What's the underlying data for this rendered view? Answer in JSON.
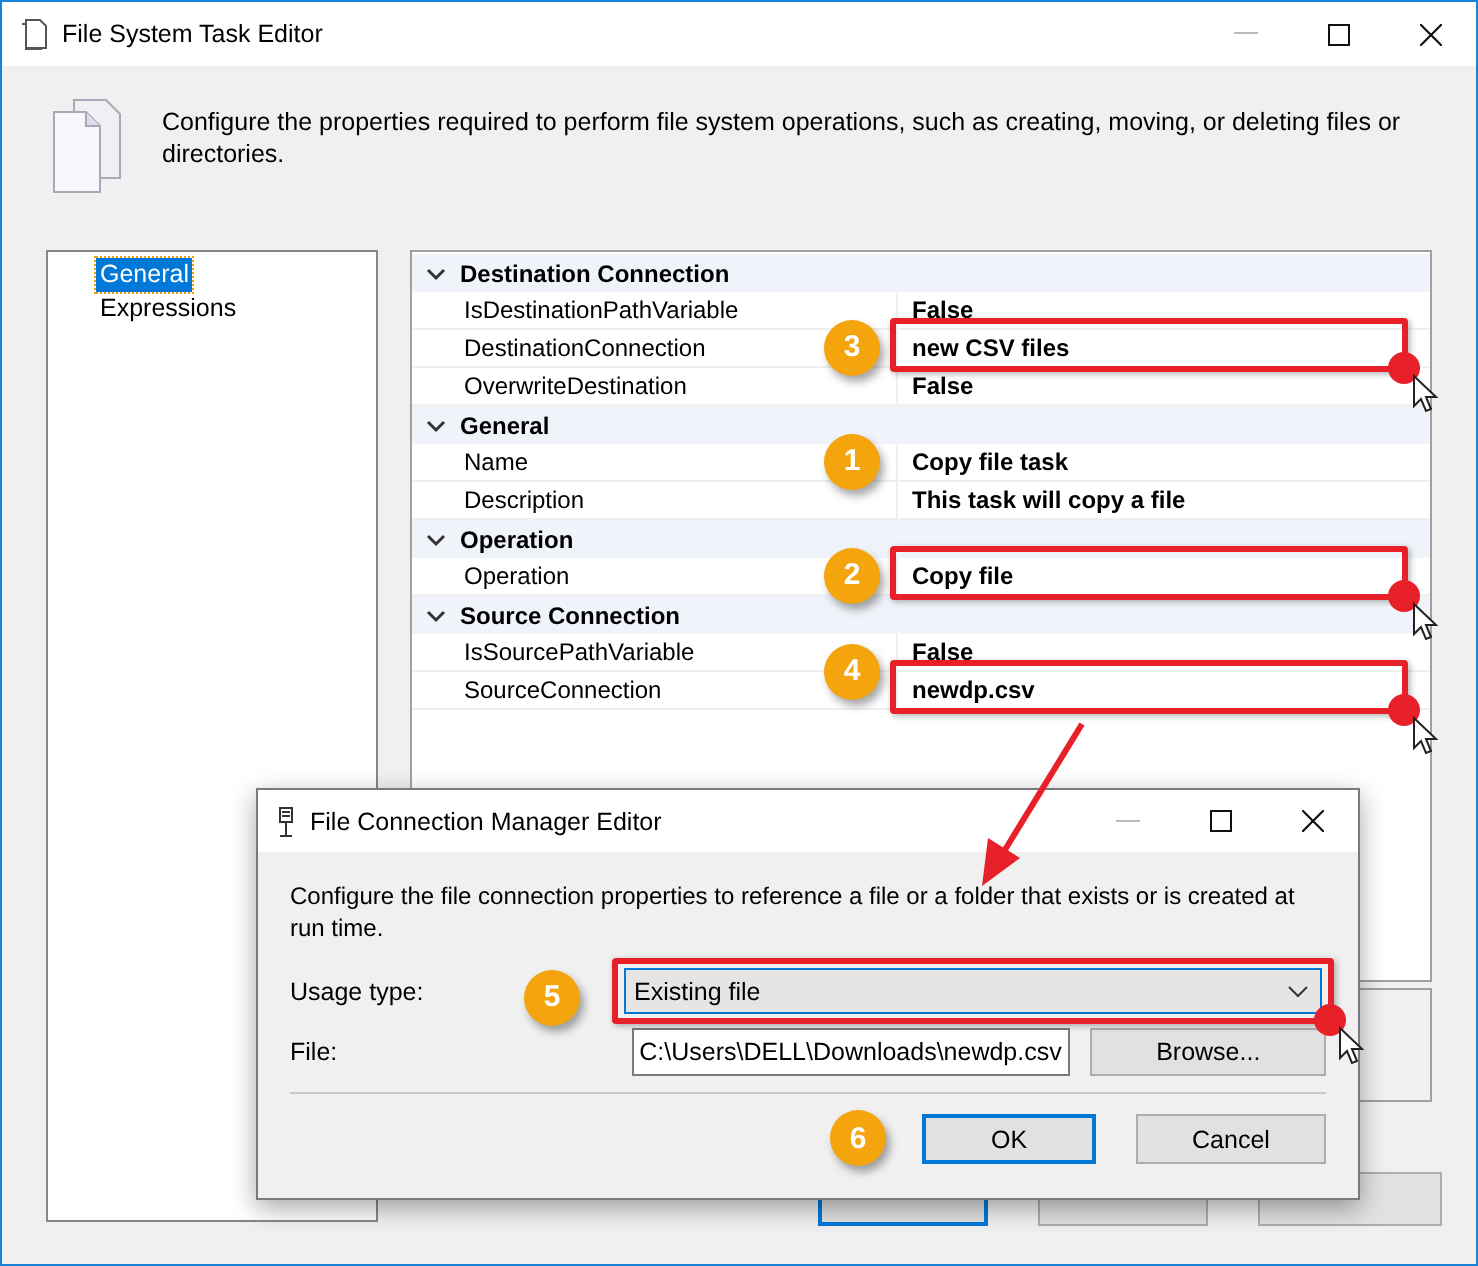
{
  "window": {
    "title": "File System Task Editor",
    "description": "Configure the properties required to perform file system operations, such as creating, moving, or deleting files or directories."
  },
  "pages": [
    {
      "label": "General",
      "selected": true
    },
    {
      "label": "Expressions",
      "selected": false
    }
  ],
  "property_grid": {
    "categories": [
      {
        "name": "Destination Connection",
        "expanded": true,
        "properties": [
          {
            "name": "IsDestinationPathVariable",
            "value": "False"
          },
          {
            "name": "DestinationConnection",
            "value": "new CSV files",
            "step": "3",
            "highlighted": true
          },
          {
            "name": "OverwriteDestination",
            "value": "False"
          }
        ]
      },
      {
        "name": "General",
        "expanded": true,
        "properties": [
          {
            "name": "Name",
            "value": "Copy file task",
            "step": "1"
          },
          {
            "name": "Description",
            "value": "This task will copy a file"
          }
        ]
      },
      {
        "name": "Operation",
        "expanded": true,
        "properties": [
          {
            "name": "Operation",
            "value": "Copy file",
            "step": "2",
            "highlighted": true
          }
        ]
      },
      {
        "name": "Source Connection",
        "expanded": true,
        "properties": [
          {
            "name": "IsSourcePathVariable",
            "value": "False"
          },
          {
            "name": "SourceConnection",
            "value": "newdp.csv",
            "step": "4",
            "highlighted": true
          }
        ]
      }
    ]
  },
  "buttons": [
    {
      "default": true
    },
    {
      "default": false
    },
    {
      "default": false
    }
  ],
  "dialog": {
    "title": "File Connection Manager Editor",
    "description": "Configure the file connection properties to reference a file or a folder that exists or is created at run time.",
    "usage_type": {
      "label": "Usage type:",
      "value": "Existing file",
      "step": "5",
      "highlighted": true
    },
    "file": {
      "label": "File:",
      "value": "C:\\Users\\DELL\\Downloads\\newdp.csv"
    },
    "browse": "Browse...",
    "buttons": [
      {
        "label": "OK",
        "default": true,
        "step": "6"
      },
      {
        "label": "Cancel",
        "default": false
      }
    ]
  }
}
